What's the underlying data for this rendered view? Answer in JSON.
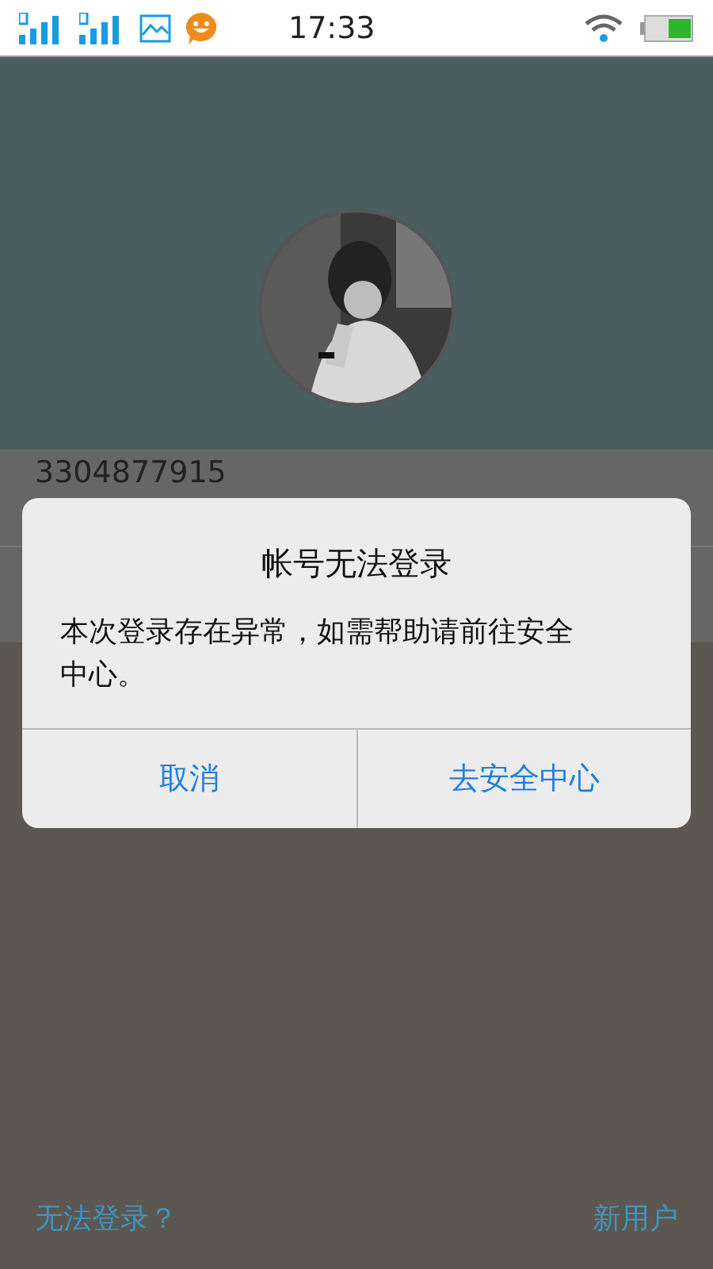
{
  "status_bar": {
    "time": "17:33"
  },
  "login": {
    "account_field": {
      "value": "3304877915"
    }
  },
  "dialog": {
    "title": "帐号无法登录",
    "message": "本次登录存在异常，如需帮助请前往安全中心。",
    "buttons": [
      "取消",
      "去安全中心"
    ]
  },
  "footer": {
    "links": [
      "无法登录？",
      "新用户"
    ]
  }
}
